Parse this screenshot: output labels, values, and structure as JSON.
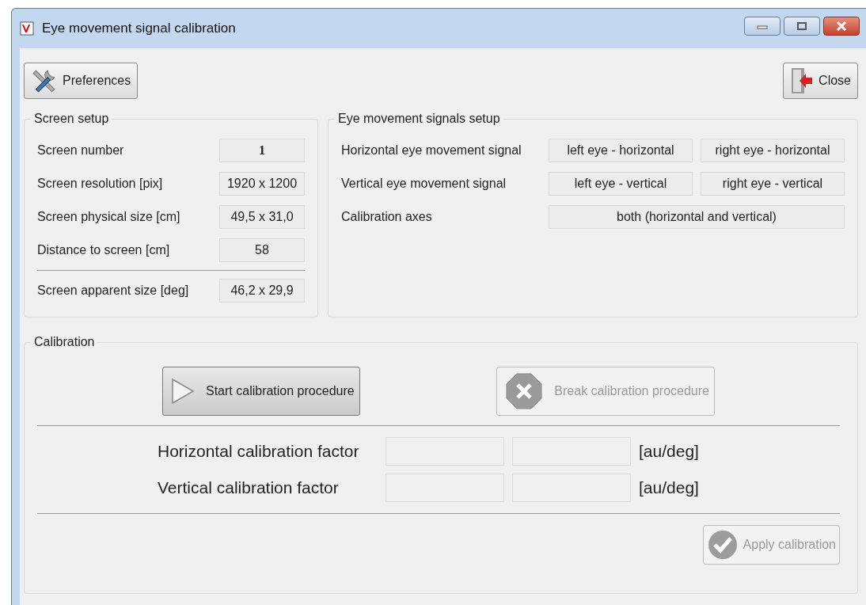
{
  "window": {
    "title": "Eye movement signal calibration"
  },
  "toolbar": {
    "preferences_button": "Preferences",
    "close_button": "Close"
  },
  "screen_setup": {
    "title": "Screen setup",
    "rows": [
      {
        "label": "Screen number",
        "value": "1",
        "bold": true
      },
      {
        "label": "Screen resolution [pix]",
        "value": "1920 x 1200",
        "bold": false
      },
      {
        "label": "Screen physical size [cm]",
        "value": "49,5 x 31,0",
        "bold": false
      },
      {
        "label": "Distance to screen [cm]",
        "value": "58",
        "bold": false
      }
    ],
    "summary_row": {
      "label": "Screen apparent size [deg]",
      "value": "46,2 x 29,9"
    }
  },
  "signals_setup": {
    "title": "Eye movement signals setup",
    "rows": [
      {
        "label": "Horizontal eye movement signal",
        "values": [
          "left eye - horizontal",
          "right eye - horizontal"
        ]
      },
      {
        "label": "Vertical eye movement signal",
        "values": [
          "left eye - vertical",
          "right eye - vertical"
        ]
      },
      {
        "label": "Calibration axes",
        "values": [
          "both (horizontal and vertical)"
        ]
      }
    ]
  },
  "calibration": {
    "title": "Calibration",
    "buttons": [
      {
        "kind": "start",
        "label": "Start calibration procedure",
        "disabled": false
      },
      {
        "kind": "break",
        "label": "Break calibration procedure",
        "disabled": true
      }
    ],
    "factors": [
      {
        "label": "Horizontal calibration factor",
        "unit": "[au/deg]"
      },
      {
        "label": "Vertical calibration factor",
        "unit": "[au/deg]"
      }
    ],
    "apply_button": {
      "label": "Apply calibration",
      "disabled": true
    }
  }
}
